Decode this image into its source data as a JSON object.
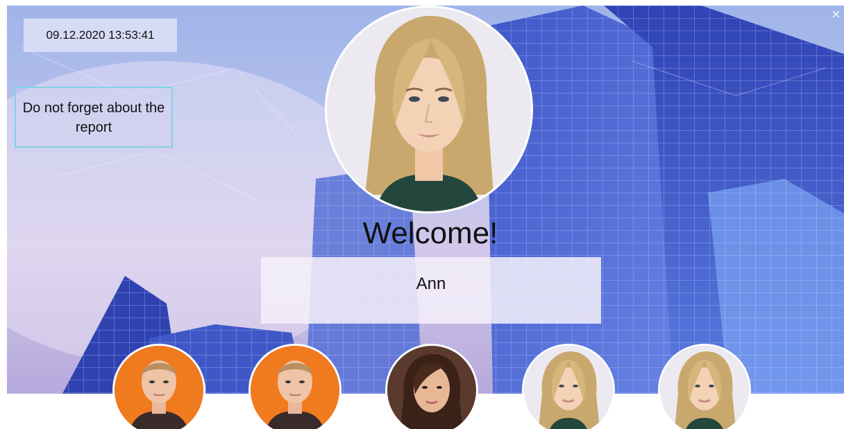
{
  "screen": {
    "datetime": "09.12.2020 13:53:41",
    "reminder": "Do not forget about the report",
    "close_glyph": "×",
    "welcome": "Welcome!",
    "visitor_name": "Ann"
  },
  "icons": {
    "close": "close-icon"
  },
  "colors": {
    "accent_border": "#7fd3e6",
    "thumb_orange": "#f07a1e",
    "sky_blue": "#9fb4ea"
  },
  "visitors": [
    {
      "id": "visitor-1"
    },
    {
      "id": "visitor-2"
    },
    {
      "id": "visitor-3"
    },
    {
      "id": "visitor-4"
    },
    {
      "id": "visitor-5"
    }
  ]
}
